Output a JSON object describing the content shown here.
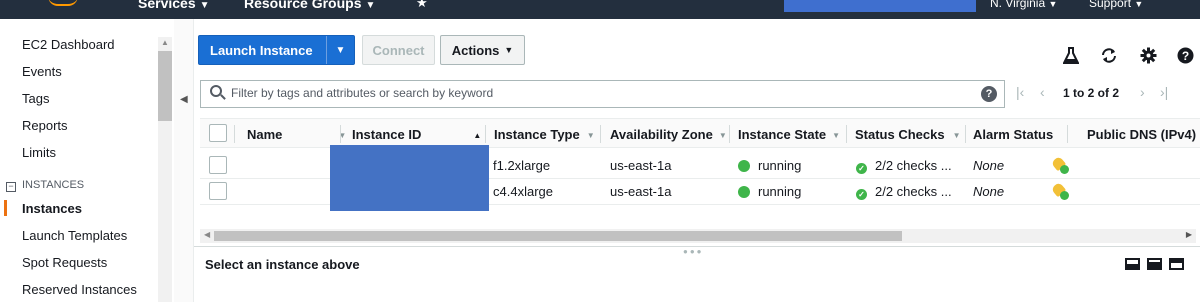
{
  "nav": {
    "services": "Services",
    "resource_groups": "Resource Groups",
    "region": "N. Virginia",
    "support": "Support",
    "star_icon": "star-icon"
  },
  "sidebar": {
    "items": [
      "EC2 Dashboard",
      "Events",
      "Tags",
      "Reports",
      "Limits"
    ],
    "section_label": "INSTANCES",
    "section_items": [
      "Instances",
      "Launch Templates",
      "Spot Requests",
      "Reserved Instances"
    ],
    "active_item": "Instances"
  },
  "toolbar": {
    "launch_label": "Launch Instance",
    "connect_label": "Connect",
    "actions_label": "Actions",
    "icons": [
      "flask-icon",
      "refresh-icon",
      "gear-icon",
      "help-icon"
    ]
  },
  "filter": {
    "placeholder": "Filter by tags and attributes or search by keyword",
    "value": ""
  },
  "pagination": {
    "range": "1 to 2 of 2"
  },
  "table": {
    "columns": [
      "Name",
      "Instance ID",
      "Instance Type",
      "Availability Zone",
      "Instance State",
      "Status Checks",
      "Alarm Status",
      "Public DNS (IPv4)"
    ],
    "rows": [
      {
        "name": "",
        "instance_id": "",
        "type": "f1.2xlarge",
        "zone": "us-east-1a",
        "state": "running",
        "checks": "2/2 checks ...",
        "alarm": "None",
        "dns": ""
      },
      {
        "name": "",
        "instance_id": "",
        "type": "c4.4xlarge",
        "zone": "us-east-1a",
        "state": "running",
        "checks": "2/2 checks ...",
        "alarm": "None",
        "dns": ""
      }
    ]
  },
  "details": {
    "message": "Select an instance above"
  },
  "colors": {
    "nav_bg": "#232f3e",
    "primary": "#1a6fd4",
    "running": "#3fb54a",
    "active_accent": "#ec7211",
    "redaction": "#4472c4"
  }
}
